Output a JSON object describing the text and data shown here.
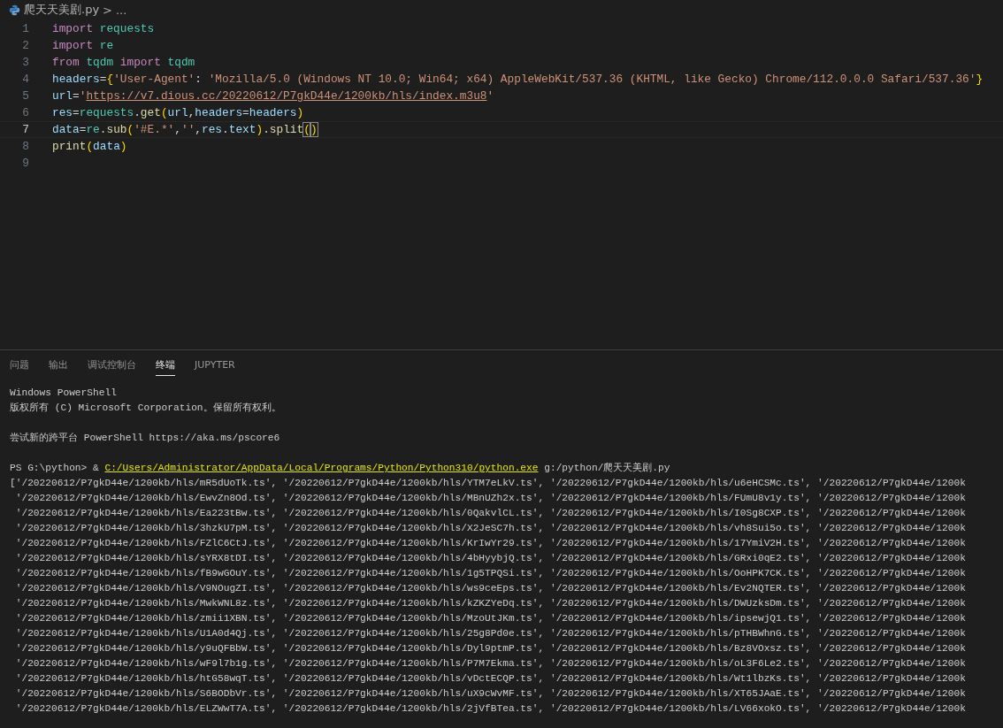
{
  "breadcrumb": {
    "file": "爬天天美剧.py",
    "separator": ">",
    "tail": "..."
  },
  "editor": {
    "lines": [
      {
        "number": "1",
        "current": false,
        "tokens": [
          {
            "kind": "keyword",
            "text": "import "
          },
          {
            "kind": "module",
            "text": "requests"
          }
        ]
      },
      {
        "number": "2",
        "current": false,
        "tokens": [
          {
            "kind": "keyword",
            "text": "import "
          },
          {
            "kind": "module",
            "text": "re"
          }
        ]
      },
      {
        "number": "3",
        "current": false,
        "tokens": [
          {
            "kind": "keyword",
            "text": "from "
          },
          {
            "kind": "module",
            "text": "tqdm "
          },
          {
            "kind": "keyword",
            "text": "import "
          },
          {
            "kind": "module",
            "text": "tqdm"
          }
        ]
      },
      {
        "number": "4",
        "current": false,
        "tokens": [
          {
            "kind": "variable",
            "text": "headers"
          },
          {
            "kind": "plain",
            "text": "="
          },
          {
            "kind": "bracket",
            "text": "{"
          },
          {
            "kind": "string",
            "text": "'User-Agent'"
          },
          {
            "kind": "plain",
            "text": ": "
          },
          {
            "kind": "string",
            "text": "'Mozilla/5.0 (Windows NT 10.0; Win64; x64) AppleWebKit/537.36 (KHTML, like Gecko) Chrome/112.0.0.0 Safari/537.36'"
          },
          {
            "kind": "bracket",
            "text": "}"
          }
        ]
      },
      {
        "number": "5",
        "current": false,
        "tokens": [
          {
            "kind": "variable",
            "text": "url"
          },
          {
            "kind": "plain",
            "text": "="
          },
          {
            "kind": "string",
            "text": "'"
          },
          {
            "kind": "link",
            "text": "https://v7.dious.cc/20220612/P7gkD44e/1200kb/hls/index.m3u8"
          },
          {
            "kind": "string",
            "text": "'"
          }
        ]
      },
      {
        "number": "6",
        "current": false,
        "tokens": [
          {
            "kind": "variable",
            "text": "res"
          },
          {
            "kind": "plain",
            "text": "="
          },
          {
            "kind": "module",
            "text": "requests"
          },
          {
            "kind": "plain",
            "text": "."
          },
          {
            "kind": "function",
            "text": "get"
          },
          {
            "kind": "bracket",
            "text": "("
          },
          {
            "kind": "variable",
            "text": "url"
          },
          {
            "kind": "plain",
            "text": ","
          },
          {
            "kind": "variable",
            "text": "headers"
          },
          {
            "kind": "plain",
            "text": "="
          },
          {
            "kind": "variable",
            "text": "headers"
          },
          {
            "kind": "bracket",
            "text": ")"
          }
        ]
      },
      {
        "number": "7",
        "current": true,
        "tokens": [
          {
            "kind": "variable",
            "text": "data"
          },
          {
            "kind": "plain",
            "text": "="
          },
          {
            "kind": "module",
            "text": "re"
          },
          {
            "kind": "plain",
            "text": "."
          },
          {
            "kind": "function",
            "text": "sub"
          },
          {
            "kind": "bracket",
            "text": "("
          },
          {
            "kind": "string",
            "text": "'#E.*'"
          },
          {
            "kind": "plain",
            "text": ","
          },
          {
            "kind": "string",
            "text": "''"
          },
          {
            "kind": "plain",
            "text": ","
          },
          {
            "kind": "variable",
            "text": "res"
          },
          {
            "kind": "plain",
            "text": "."
          },
          {
            "kind": "variable",
            "text": "text"
          },
          {
            "kind": "bracket",
            "text": ")"
          },
          {
            "kind": "plain",
            "text": "."
          },
          {
            "kind": "function",
            "text": "split"
          },
          {
            "kind": "matched",
            "text": "("
          },
          {
            "kind": "matched",
            "text": ")"
          }
        ]
      },
      {
        "number": "8",
        "current": false,
        "tokens": [
          {
            "kind": "function",
            "text": "print"
          },
          {
            "kind": "bracket",
            "text": "("
          },
          {
            "kind": "variable",
            "text": "data"
          },
          {
            "kind": "bracket",
            "text": ")"
          }
        ]
      },
      {
        "number": "9",
        "current": false
      }
    ]
  },
  "panel": {
    "tabs": [
      {
        "label": "问题",
        "selected": false
      },
      {
        "label": "输出",
        "selected": false
      },
      {
        "label": "调试控制台",
        "selected": false
      },
      {
        "label": "终端",
        "selected": true
      },
      {
        "label": "JUPYTER",
        "selected": false
      }
    ]
  },
  "terminal": {
    "lines": [
      {
        "kind": "text",
        "text": "Windows PowerShell"
      },
      {
        "kind": "text",
        "text": "版权所有 (C) Microsoft Corporation。保留所有权利。"
      },
      {
        "kind": "blank"
      },
      {
        "kind": "text",
        "text": "尝试新的跨平台 PowerShell https://aka.ms/pscore6"
      },
      {
        "kind": "blank"
      },
      {
        "kind": "prompt",
        "prompt": "PS G:\\python> & ",
        "command": "C:/Users/Administrator/AppData/Local/Programs/Python/Python310/python.exe",
        "args": " g:/python/爬天天美剧.py"
      },
      {
        "kind": "text",
        "text": "['/20220612/P7gkD44e/1200kb/hls/mR5dUoTk.ts', '/20220612/P7gkD44e/1200kb/hls/YTM7eLkV.ts', '/20220612/P7gkD44e/1200kb/hls/u6eHCSMc.ts', '/20220612/P7gkD44e/1200k"
      },
      {
        "kind": "text",
        "text": " '/20220612/P7gkD44e/1200kb/hls/EwvZn8Od.ts', '/20220612/P7gkD44e/1200kb/hls/MBnUZh2x.ts', '/20220612/P7gkD44e/1200kb/hls/FUmU8v1y.ts', '/20220612/P7gkD44e/1200k"
      },
      {
        "kind": "text",
        "text": " '/20220612/P7gkD44e/1200kb/hls/Ea223tBw.ts', '/20220612/P7gkD44e/1200kb/hls/0QakvlCL.ts', '/20220612/P7gkD44e/1200kb/hls/I0Sg8CXP.ts', '/20220612/P7gkD44e/1200k"
      },
      {
        "kind": "text",
        "text": " '/20220612/P7gkD44e/1200kb/hls/3hzkU7pM.ts', '/20220612/P7gkD44e/1200kb/hls/X2JeSC7h.ts', '/20220612/P7gkD44e/1200kb/hls/vh8Sui5o.ts', '/20220612/P7gkD44e/1200k"
      },
      {
        "kind": "text",
        "text": " '/20220612/P7gkD44e/1200kb/hls/FZlC6CtJ.ts', '/20220612/P7gkD44e/1200kb/hls/KrIwYr29.ts', '/20220612/P7gkD44e/1200kb/hls/17YmiV2H.ts', '/20220612/P7gkD44e/1200k"
      },
      {
        "kind": "text",
        "text": " '/20220612/P7gkD44e/1200kb/hls/sYRX8tDI.ts', '/20220612/P7gkD44e/1200kb/hls/4bHyybjQ.ts', '/20220612/P7gkD44e/1200kb/hls/GRxi0qE2.ts', '/20220612/P7gkD44e/1200k"
      },
      {
        "kind": "text",
        "text": " '/20220612/P7gkD44e/1200kb/hls/fB9wGOuY.ts', '/20220612/P7gkD44e/1200kb/hls/1g5TPQSi.ts', '/20220612/P7gkD44e/1200kb/hls/OoHPK7CK.ts', '/20220612/P7gkD44e/1200k"
      },
      {
        "kind": "text",
        "text": " '/20220612/P7gkD44e/1200kb/hls/V9NOugZI.ts', '/20220612/P7gkD44e/1200kb/hls/ws9ceEps.ts', '/20220612/P7gkD44e/1200kb/hls/Ev2NQTER.ts', '/20220612/P7gkD44e/1200k"
      },
      {
        "kind": "text",
        "text": " '/20220612/P7gkD44e/1200kb/hls/MwkWNL8z.ts', '/20220612/P7gkD44e/1200kb/hls/kZKZYeDq.ts', '/20220612/P7gkD44e/1200kb/hls/DWUzksDm.ts', '/20220612/P7gkD44e/1200k"
      },
      {
        "kind": "text",
        "text": " '/20220612/P7gkD44e/1200kb/hls/zmii1XBN.ts', '/20220612/P7gkD44e/1200kb/hls/MzoUtJKm.ts', '/20220612/P7gkD44e/1200kb/hls/ipsewjQ1.ts', '/20220612/P7gkD44e/1200k"
      },
      {
        "kind": "text",
        "text": " '/20220612/P7gkD44e/1200kb/hls/U1A0d4Qj.ts', '/20220612/P7gkD44e/1200kb/hls/25g8Pd0e.ts', '/20220612/P7gkD44e/1200kb/hls/pTHBWhnG.ts', '/20220612/P7gkD44e/1200k"
      },
      {
        "kind": "text",
        "text": " '/20220612/P7gkD44e/1200kb/hls/y9uQFBbW.ts', '/20220612/P7gkD44e/1200kb/hls/Dyl9ptmP.ts', '/20220612/P7gkD44e/1200kb/hls/Bz8VOxsz.ts', '/20220612/P7gkD44e/1200k"
      },
      {
        "kind": "text",
        "text": " '/20220612/P7gkD44e/1200kb/hls/wF9l7b1g.ts', '/20220612/P7gkD44e/1200kb/hls/P7M7Ekma.ts', '/20220612/P7gkD44e/1200kb/hls/oL3F6Le2.ts', '/20220612/P7gkD44e/1200k"
      },
      {
        "kind": "text",
        "text": " '/20220612/P7gkD44e/1200kb/hls/htG58wqT.ts', '/20220612/P7gkD44e/1200kb/hls/vDctECQP.ts', '/20220612/P7gkD44e/1200kb/hls/Wt1lbzKs.ts', '/20220612/P7gkD44e/1200k"
      },
      {
        "kind": "text",
        "text": " '/20220612/P7gkD44e/1200kb/hls/S6BODbVr.ts', '/20220612/P7gkD44e/1200kb/hls/uX9cWvMF.ts', '/20220612/P7gkD44e/1200kb/hls/XT65JAaE.ts', '/20220612/P7gkD44e/1200k"
      },
      {
        "kind": "text",
        "text": " '/20220612/P7gkD44e/1200kb/hls/ELZWwT7A.ts', '/20220612/P7gkD44e/1200kb/hls/2jVfBTea.ts', '/20220612/P7gkD44e/1200kb/hls/LV66xokO.ts', '/20220612/P7gkD44e/1200k"
      }
    ]
  }
}
